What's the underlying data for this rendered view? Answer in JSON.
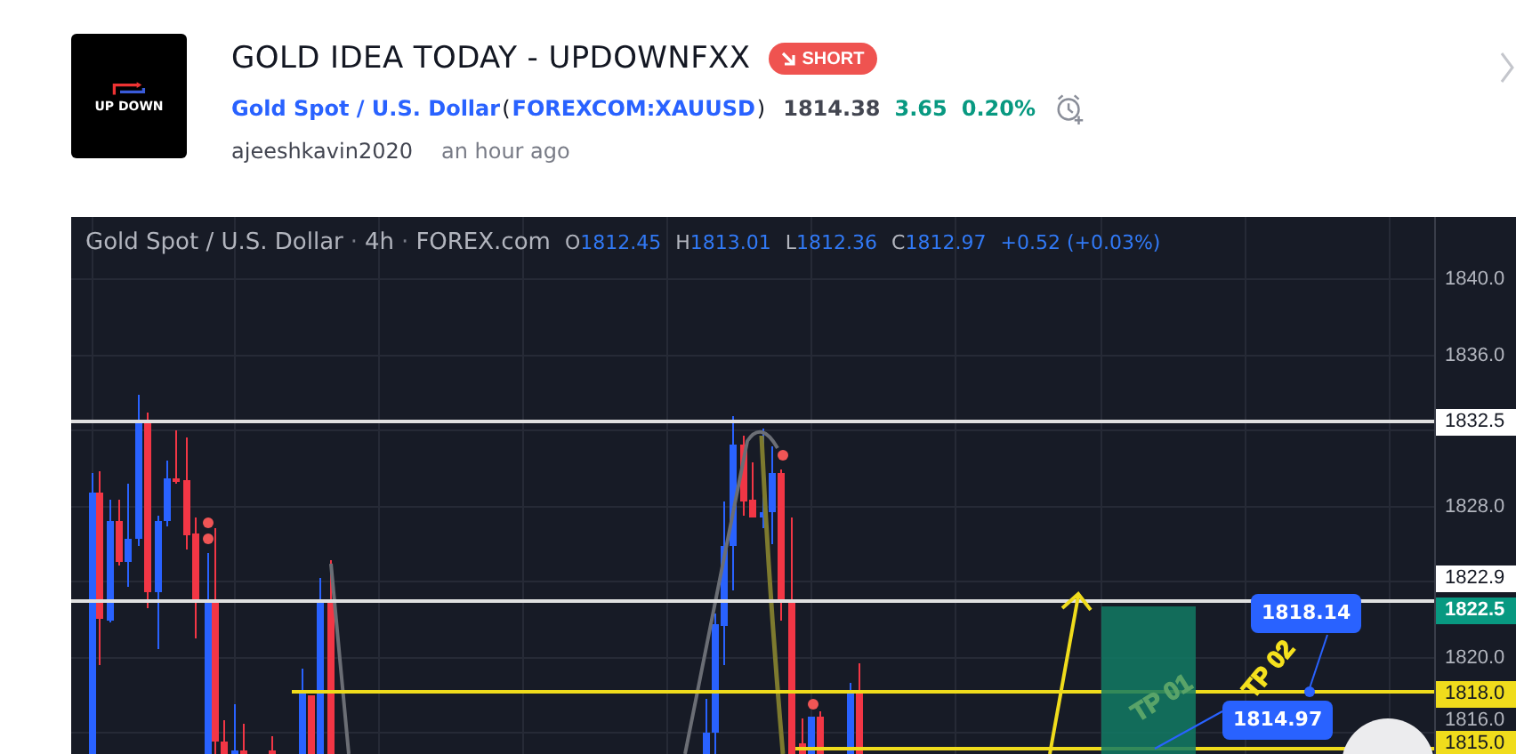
{
  "idea": {
    "logo_text": "UP DOWN",
    "title": "GOLD IDEA TODAY - UPDOWNFXX",
    "badge": {
      "kind": "short",
      "label": "SHORT"
    },
    "symbol_name": "Gold Spot / U.S. Dollar",
    "open_paren": "(",
    "symbol_code": "FOREXCOM:XAUUSD",
    "close_paren": ")",
    "price": "1814.38",
    "change": "3.65",
    "change_percent": "0.20%",
    "author": "ajeeshkavin2020",
    "time": "an hour ago"
  },
  "chart": {
    "legend": [
      {
        "kind": "text",
        "text": "Gold Spot / U.S. Dollar"
      },
      {
        "kind": "sep",
        "text": "·"
      },
      {
        "kind": "text",
        "text": "4h"
      },
      {
        "kind": "sep",
        "text": "·"
      },
      {
        "kind": "text",
        "text": "FOREX.com"
      },
      {
        "kind": "ohlc",
        "label": "O",
        "text": "1812.45"
      },
      {
        "kind": "ohlc",
        "label": "H",
        "text": "1813.01"
      },
      {
        "kind": "ohlc",
        "label": "L",
        "text": "1812.36"
      },
      {
        "kind": "ohlc",
        "label": "C",
        "text": "1812.97"
      },
      {
        "kind": "change",
        "text": "+0.52 (+0.03%)"
      }
    ],
    "price_axis": [
      {
        "kind": "plain",
        "text": "1840.0"
      },
      {
        "kind": "plain",
        "text": "1836.0"
      },
      {
        "kind": "white",
        "text": "1832.5"
      },
      {
        "kind": "plain",
        "text": "1828.0"
      },
      {
        "kind": "white",
        "text": "1822.9"
      },
      {
        "kind": "teal",
        "text": "1822.5"
      },
      {
        "kind": "plain",
        "text": "1820.0"
      },
      {
        "kind": "yellow",
        "text": "1818.0"
      },
      {
        "kind": "plain",
        "text": "1816.0"
      },
      {
        "kind": "yellow",
        "text": "1815.0"
      }
    ],
    "callouts": [
      "1818.14",
      "1814.97"
    ],
    "targets": [
      {
        "text": "TP 01",
        "color": "#5aa469"
      },
      {
        "text": "TP 02",
        "color": "#f5e11e"
      }
    ]
  }
}
